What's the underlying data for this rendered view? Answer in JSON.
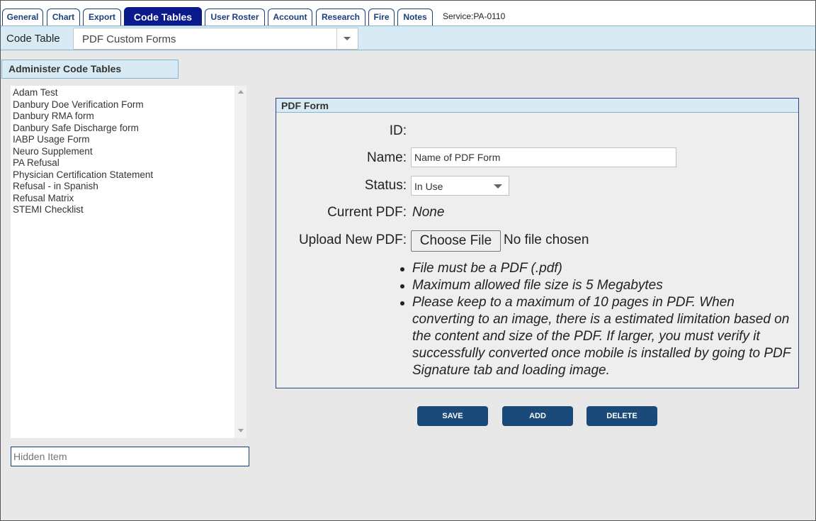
{
  "tabs": [
    {
      "label": "General"
    },
    {
      "label": "Chart"
    },
    {
      "label": "Export"
    },
    {
      "label": "Code Tables",
      "active": true
    },
    {
      "label": "User Roster"
    },
    {
      "label": "Account"
    },
    {
      "label": "Research"
    },
    {
      "label": "Fire"
    },
    {
      "label": "Notes"
    }
  ],
  "service": "Service:PA-0110",
  "code_table": {
    "label": "Code Table",
    "selected": "PDF Custom Forms"
  },
  "admin": {
    "title": "Administer Code Tables",
    "items": [
      "Adam Test",
      "Danbury Doe Verification Form",
      "Danbury RMA form",
      "Danbury Safe Discharge form",
      "IABP Usage Form",
      "Neuro Supplement",
      "PA Refusal",
      "Physician Certification Statement",
      "Refusal - in Spanish",
      "Refusal Matrix",
      "STEMI Checklist"
    ],
    "hidden_item_placeholder": "Hidden Item"
  },
  "form": {
    "title": "PDF Form",
    "id_label": "ID:",
    "name_label": "Name:",
    "name_value": "Name of PDF Form",
    "status_label": "Status:",
    "status_value": "In Use",
    "current_pdf_label": "Current PDF:",
    "current_pdf_value": "None",
    "upload_label": "Upload New PDF:",
    "choose_file": "Choose File",
    "no_file": "No file chosen",
    "notes": [
      "File must be a PDF (.pdf)",
      "Maximum allowed file size is 5 Megabytes",
      "Please keep to a maximum of 10 pages in PDF. When converting to an image, there is a estimated limitation based on the content and size of the PDF. If larger, you must verify it successfully converted once mobile is installed by going to PDF Signature tab and loading image."
    ]
  },
  "actions": {
    "save": "SAVE",
    "add": "ADD",
    "delete": "DELETE"
  },
  "colors": {
    "active_tab": "#0a1a8c",
    "tab_text": "#1b3f7a",
    "header_bg": "#d8ebf4",
    "action_button": "#1a4a7a"
  }
}
